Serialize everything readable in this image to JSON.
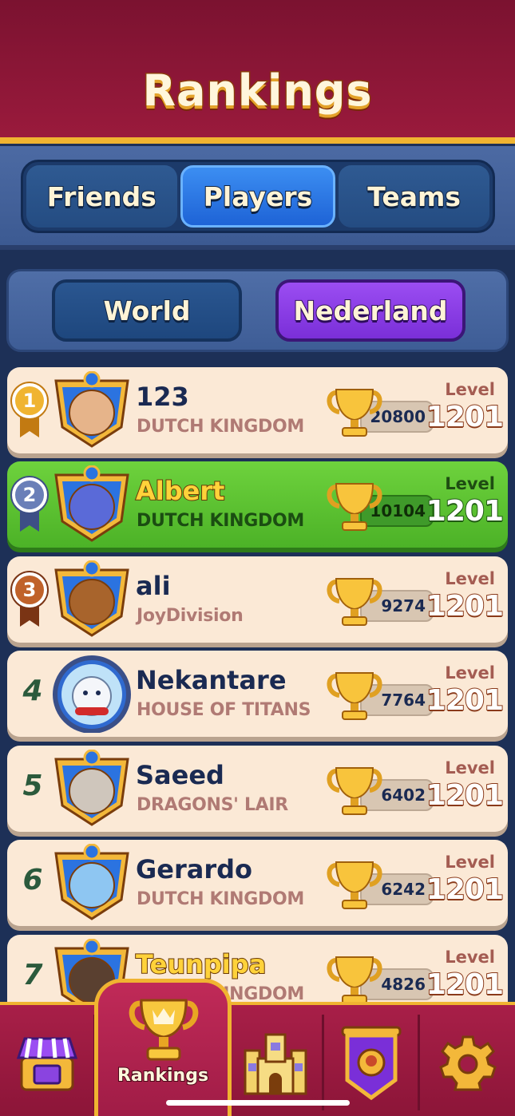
{
  "header": {
    "title": "Rankings"
  },
  "tabs": [
    {
      "label": "Friends",
      "active": false
    },
    {
      "label": "Players",
      "active": true
    },
    {
      "label": "Teams",
      "active": false
    }
  ],
  "region": {
    "world_label": "World",
    "local_label": "Nederland",
    "selected": "Nederland"
  },
  "level_label": "Level",
  "players": [
    {
      "rank": "1",
      "name": "123",
      "team": "DUTCH KINGDOM",
      "score": "20800",
      "level": "1201"
    },
    {
      "rank": "2",
      "name": "Albert",
      "team": "DUTCH KINGDOM",
      "score": "10104",
      "level": "1201",
      "is_self": true
    },
    {
      "rank": "3",
      "name": "ali",
      "team": "JoyDivision",
      "score": "9274",
      "level": "1201"
    },
    {
      "rank": "4",
      "name": "Nekantare",
      "team": "HOUSE OF TITANS",
      "score": "7764",
      "level": "1201"
    },
    {
      "rank": "5",
      "name": "Saeed",
      "team": "DRAGONS' LAIR",
      "score": "6402",
      "level": "1201"
    },
    {
      "rank": "6",
      "name": "Gerardo",
      "team": "DUTCH KINGDOM",
      "score": "6242",
      "level": "1201"
    },
    {
      "rank": "7",
      "name": "Teunpipa",
      "team": "DUTCH KINGDOM",
      "score": "4826",
      "level": "1201"
    }
  ],
  "bottom_nav": {
    "items": [
      "shop-icon",
      "rankings-trophy-icon",
      "castle-icon",
      "team-banner-icon",
      "settings-gear-icon"
    ],
    "active_label": "Rankings"
  },
  "colors": {
    "header": "#8c1538",
    "tab_active": "#1e63d6",
    "region_active": "#7a2fd8",
    "self_row": "#4cb227",
    "row_bg": "#fbe9d6",
    "gold": "#f0b431"
  }
}
